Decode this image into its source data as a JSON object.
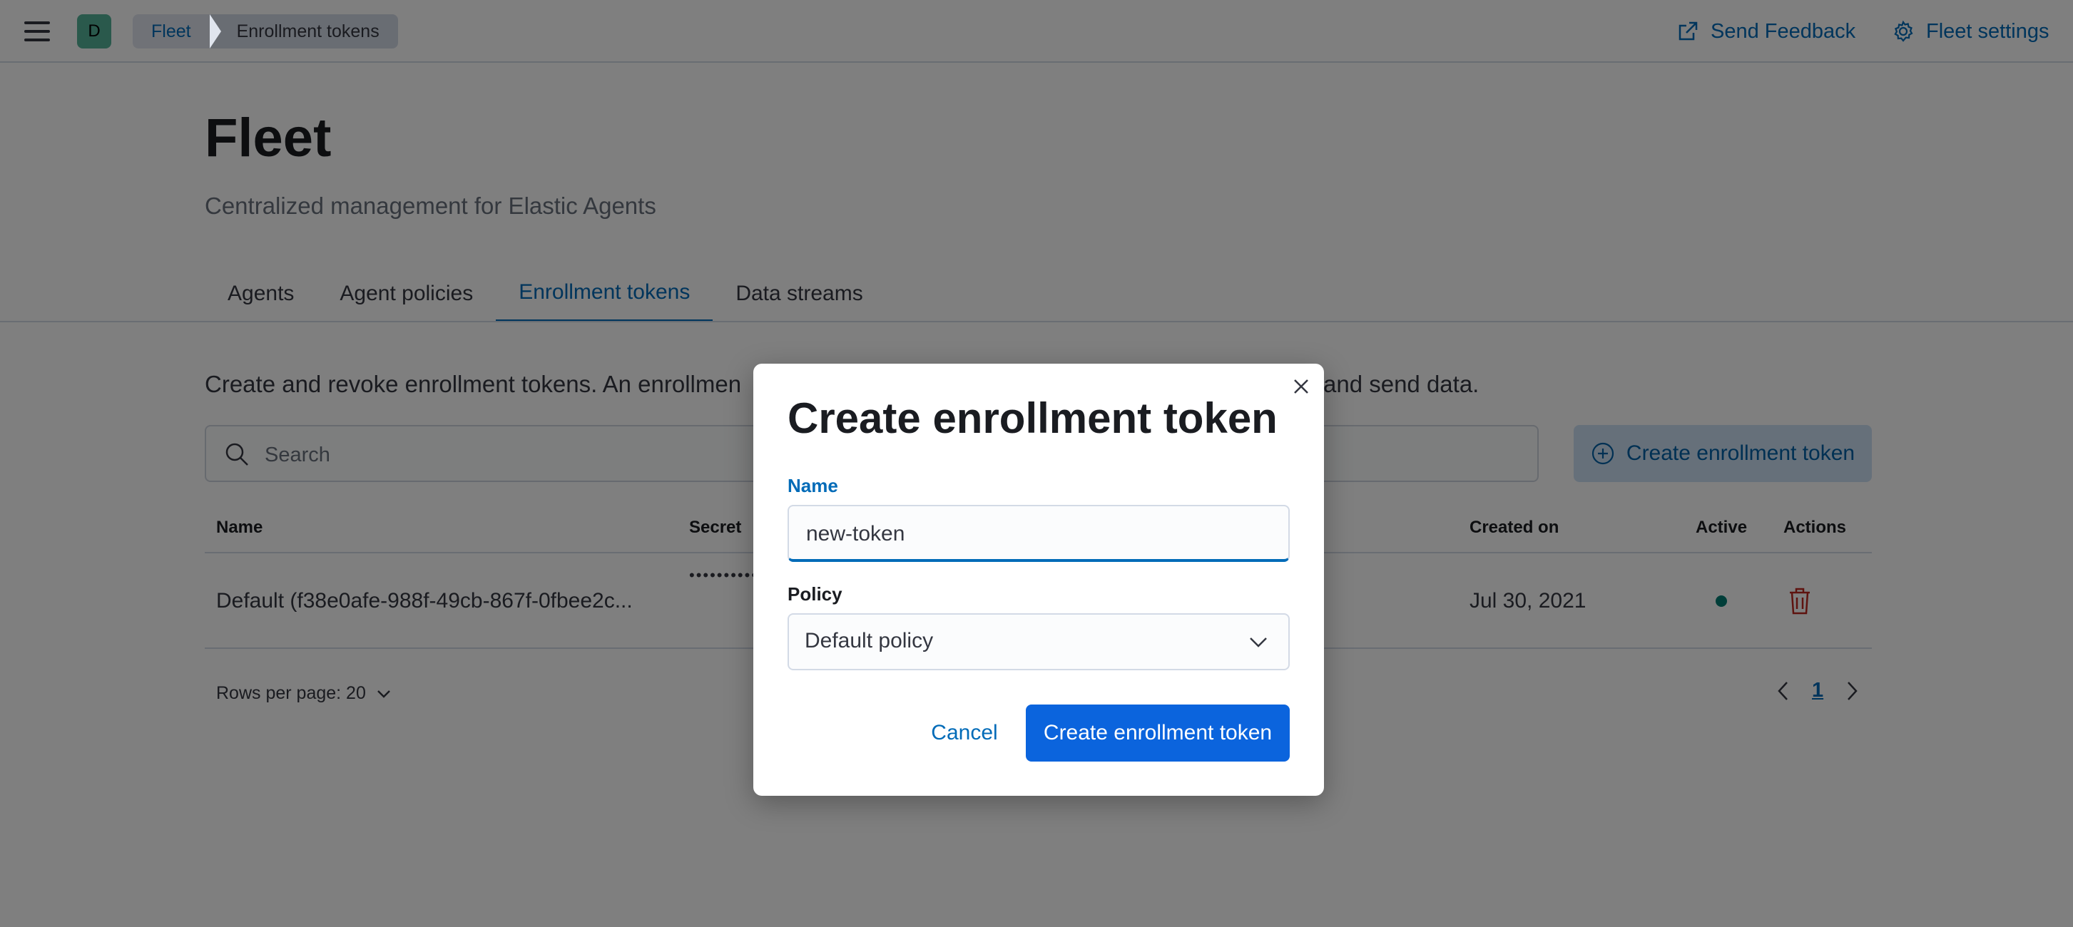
{
  "header": {
    "avatar_initial": "D",
    "breadcrumbs": [
      "Fleet",
      "Enrollment tokens"
    ],
    "send_feedback": "Send Feedback",
    "fleet_settings": "Fleet settings"
  },
  "page": {
    "title": "Fleet",
    "subtitle": "Centralized management for Elastic Agents",
    "tabs": [
      {
        "label": "Agents",
        "active": false
      },
      {
        "label": "Agent policies",
        "active": false
      },
      {
        "label": "Enrollment tokens",
        "active": true
      },
      {
        "label": "Data streams",
        "active": false
      }
    ],
    "description_visible_start": "Create and revoke enrollment tokens. An enrollmen",
    "description_visible_end": "and send data.",
    "search_placeholder": "Search",
    "create_button": "Create enrollment token"
  },
  "table": {
    "columns": [
      "Name",
      "Secret",
      "Created on",
      "Active",
      "Actions"
    ],
    "rows": [
      {
        "name": "Default (f38e0afe-988f-49cb-867f-0fbee2c...",
        "secret_masked": "•••••••••••••••••••••••••••••••••",
        "created_on": "Jul 30, 2021",
        "active": true
      }
    ],
    "rows_per_page": "Rows per page: 20",
    "current_page": "1"
  },
  "modal": {
    "title": "Create enrollment token",
    "name_label": "Name",
    "name_value": "new-token",
    "policy_label": "Policy",
    "policy_value": "Default policy",
    "cancel": "Cancel",
    "submit": "Create enrollment token"
  },
  "colors": {
    "accent": "#006bb8",
    "primary_button": "#0b64dd",
    "status_active": "#017d73",
    "danger": "#bd271e",
    "avatar": "#54b399"
  },
  "icons": [
    "menu-icon",
    "external-link-icon",
    "gear-icon",
    "search-icon",
    "plus-in-circle-icon",
    "trash-icon",
    "chevron-down-icon",
    "chevron-left-icon",
    "chevron-right-icon",
    "close-icon"
  ]
}
